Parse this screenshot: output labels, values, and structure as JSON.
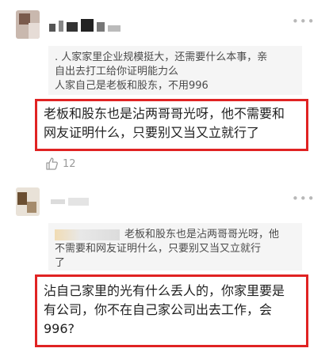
{
  "comment1": {
    "menu_glyph": "•••",
    "quote_lines": [
      ". 人家家里企业规模挺大，还需要什么本事，亲",
      "自出去打工给你证明能力么",
      "人家自己是老板和股东，不用996"
    ],
    "reply_lines": [
      "老板和股东也是沾两哥哥光呀，他不需要和",
      "网友证明什么，只要别又当又立就行了"
    ],
    "like_count": "12"
  },
  "comment2": {
    "menu_glyph": "•••",
    "quote_lines": [
      "老板和股东也是沾两哥哥光呀，他",
      "不需要和网友证明什么，只要别又当又立就行",
      "了"
    ],
    "reply_lines": [
      "沾自己家里的光有什么丢人的，你家里要是",
      "有公司，你不在自己家公司出去工作，会",
      "996?"
    ]
  },
  "colors": {
    "highlight_border": "#e02323",
    "quote_bg": "#f5f5f5"
  }
}
